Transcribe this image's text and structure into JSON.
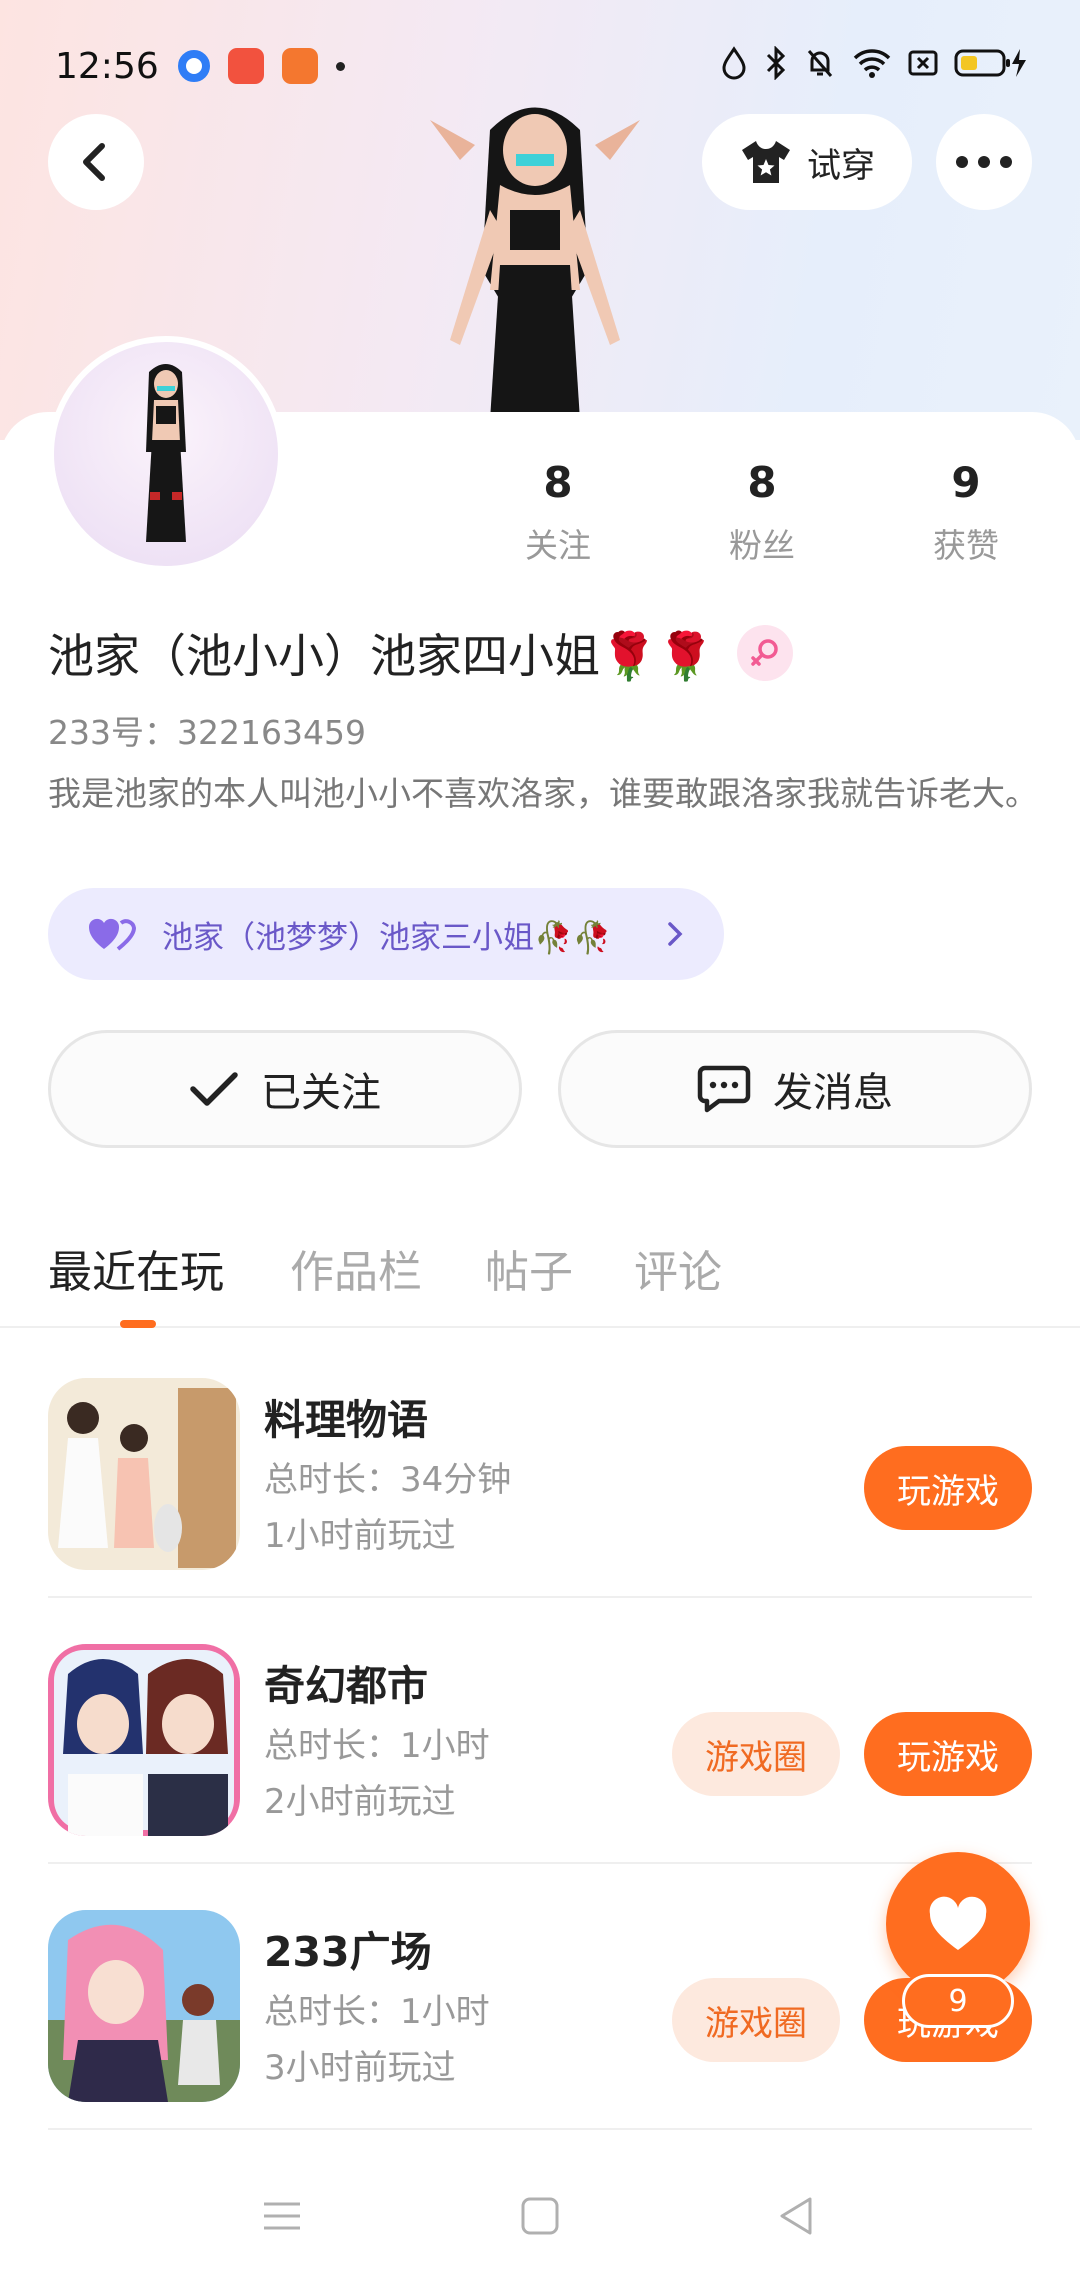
{
  "status_bar": {
    "time": "12:56"
  },
  "header": {
    "try_on_label": "试穿"
  },
  "profile": {
    "stats": [
      {
        "value": "8",
        "label": "关注"
      },
      {
        "value": "8",
        "label": "粉丝"
      },
      {
        "value": "9",
        "label": "获赞"
      }
    ],
    "name": "池家（池小小）池家四小姐🌹🌹",
    "uid": "233号：322163459",
    "bio": "我是池家的本人叫池小小不喜欢洛家，谁要敢跟洛家我就告诉老大。",
    "cp_link": "池家（池梦梦）池家三小姐🥀🥀",
    "follow_label": "已关注",
    "message_label": "发消息"
  },
  "tabs": [
    "最近在玩",
    "作品栏",
    "帖子",
    "评论"
  ],
  "games": [
    {
      "name": "料理物语",
      "duration": "总时长：34分钟",
      "last_played": "1小时前玩过",
      "play_label": "玩游戏",
      "circle_label": ""
    },
    {
      "name": "奇幻都市",
      "duration": "总时长：1小时",
      "last_played": "2小时前玩过",
      "play_label": "玩游戏",
      "circle_label": "游戏圈"
    },
    {
      "name": "233广场",
      "duration": "总时长：1小时",
      "last_played": "3小时前玩过",
      "play_label": "玩游戏",
      "circle_label": "游戏圈"
    }
  ],
  "like_fab": {
    "count": "9"
  },
  "colors": {
    "accent": "#ff6d1f",
    "accent_light": "#fde9de",
    "cp_bg": "#ecebfe",
    "cp_text": "#6a58c8"
  }
}
